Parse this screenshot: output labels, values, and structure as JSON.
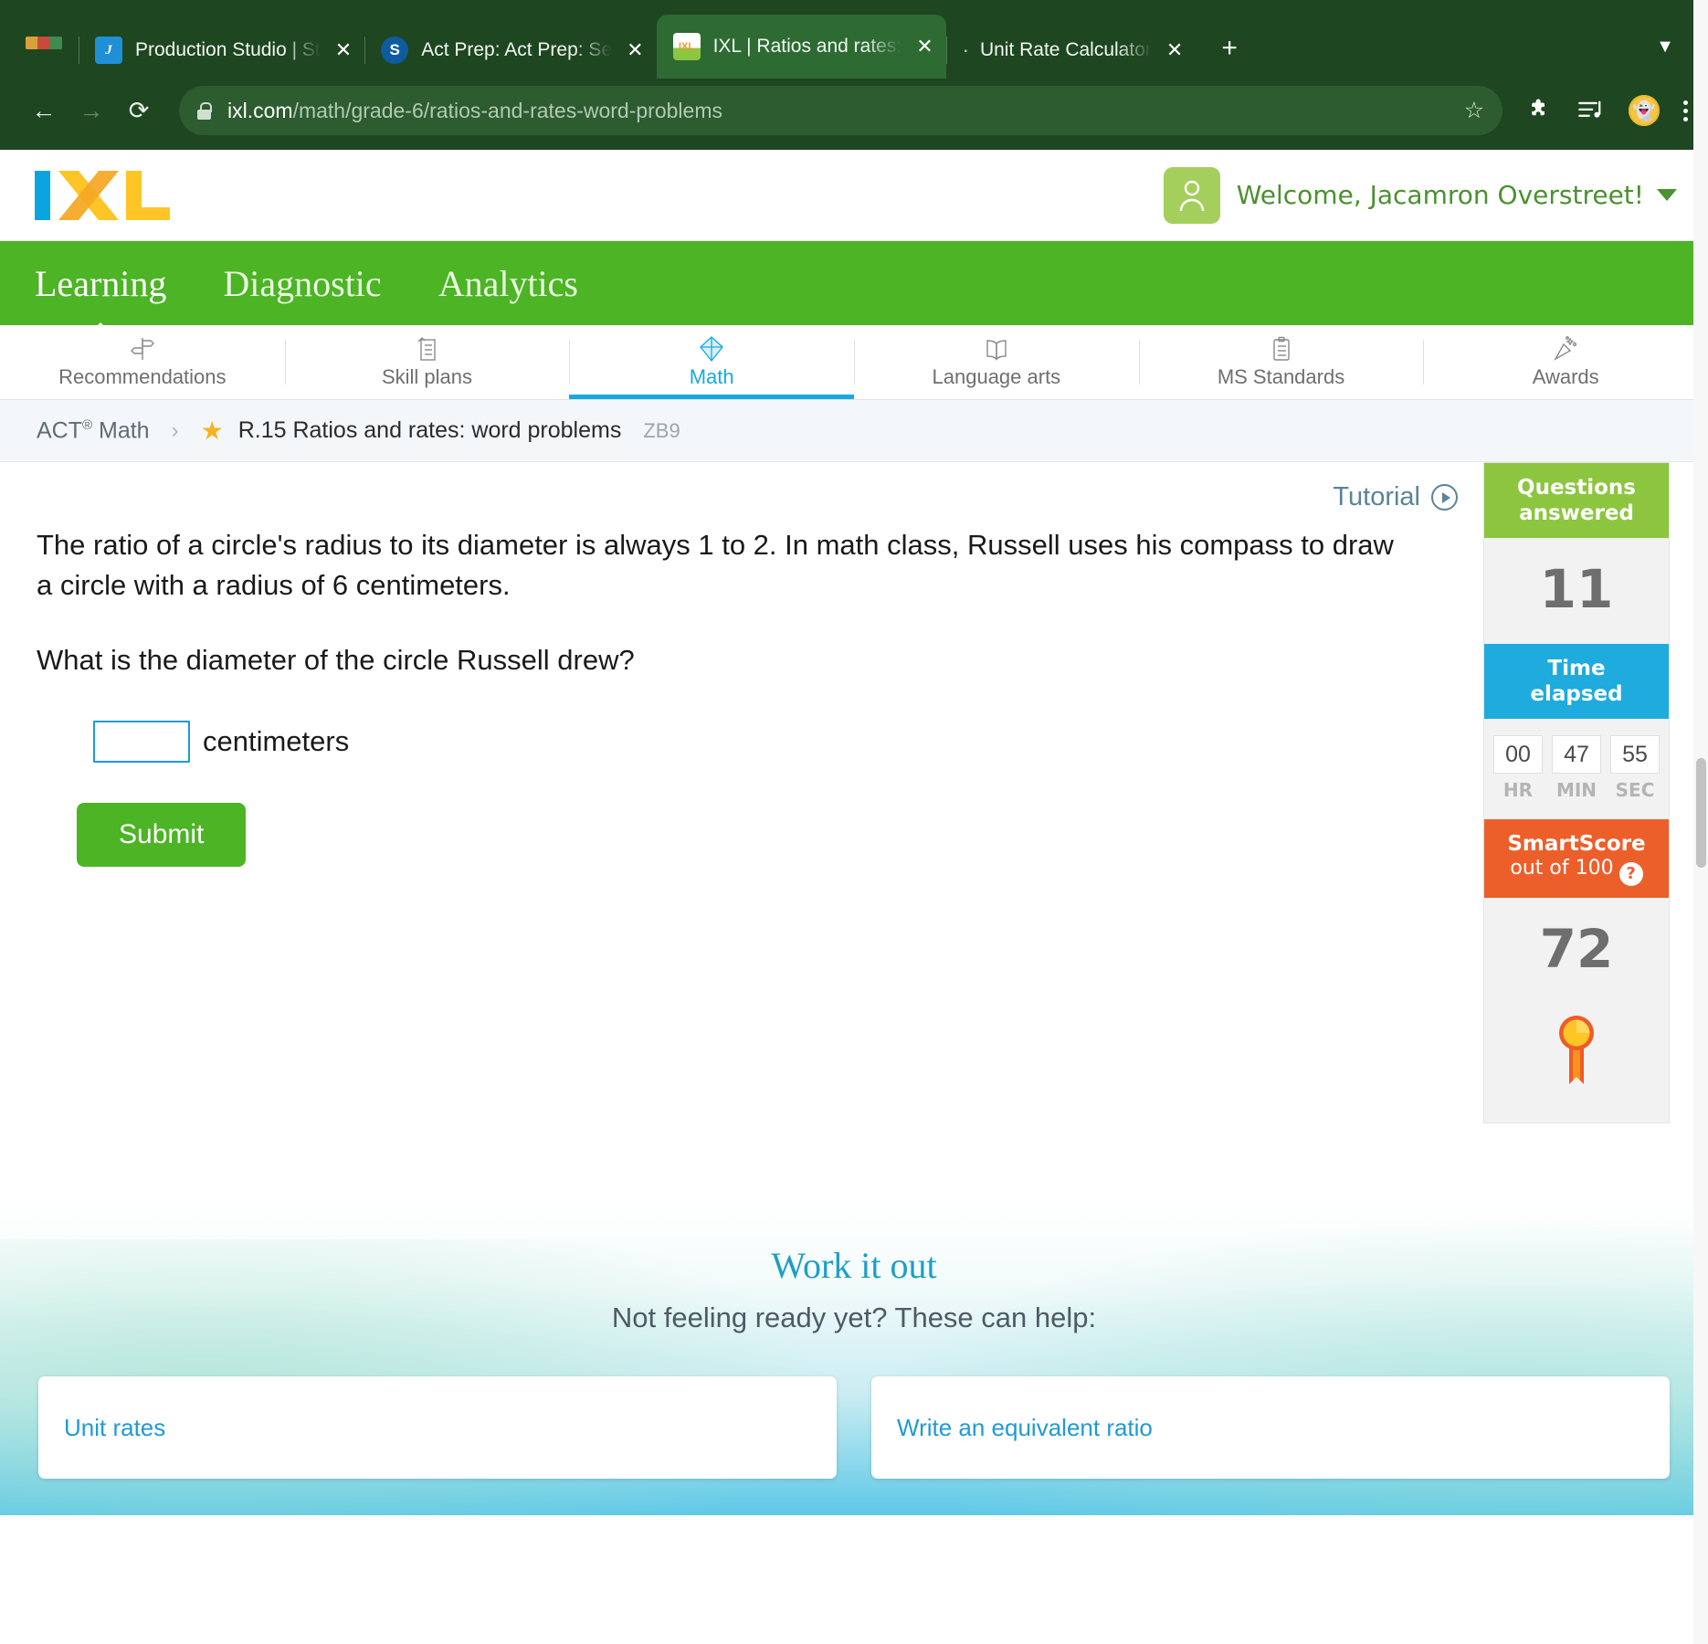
{
  "browser": {
    "tabs": [
      {
        "title": "Production Studio | St",
        "favicon": "production-studio-icon",
        "close": "✕",
        "active": false
      },
      {
        "title": "Act Prep: Act Prep: Se",
        "favicon": "act-prep-icon",
        "close": "✕",
        "active": false
      },
      {
        "title": "IXL | Ratios and rates:",
        "favicon": "ixl-icon",
        "close": "✕",
        "active": true
      },
      {
        "title": "Unit Rate Calculator",
        "favicon": "bullet-icon",
        "close": "✕",
        "active": false
      }
    ],
    "new_tab_label": "+",
    "url_prefix": "ixl.com",
    "url_path": "/math/grade-6/ratios-and-rates-word-problems",
    "url_full": "ixl.com/math/grade-6/ratios-and-rates-word-problems",
    "icons": {
      "back": "←",
      "forward": "→",
      "reload": "⟳",
      "lock": "lock-icon",
      "bookmark": "☆",
      "extensions": "puzzle-icon",
      "media": "media-icon",
      "profile": "snapchat-avatar-icon",
      "menu": "kebab-menu-icon",
      "tab_list": "tab-list-icon"
    }
  },
  "header": {
    "logo_text": "IXL",
    "welcome": "Welcome, Jacamron Overstreet!",
    "user_icon": "user-avatar-icon",
    "caret": "chevron-down-icon"
  },
  "main_nav": {
    "items": [
      {
        "label": "Learning",
        "active": true
      },
      {
        "label": "Diagnostic",
        "active": false
      },
      {
        "label": "Analytics",
        "active": false
      }
    ]
  },
  "subject_tabs": [
    {
      "label": "Recommendations",
      "icon": "signpost-icon",
      "active": false
    },
    {
      "label": "Skill plans",
      "icon": "checklist-icon",
      "active": false
    },
    {
      "label": "Math",
      "icon": "diamond-icon",
      "active": true
    },
    {
      "label": "Language arts",
      "icon": "open-book-icon",
      "active": false
    },
    {
      "label": "MS Standards",
      "icon": "clipboard-icon",
      "active": false
    },
    {
      "label": "Awards",
      "icon": "party-popper-icon",
      "active": false
    }
  ],
  "breadcrumb": {
    "root": "ACT",
    "root_sup": "®",
    "root_tail": " Math",
    "separator": "›",
    "star": "★",
    "current": "R.15 Ratios and rates: word problems",
    "code": "ZB9"
  },
  "question": {
    "tutorial_label": "Tutorial",
    "play_icon": "play-circle-icon",
    "paragraph1": "The ratio of a circle's radius to its diameter is always 1 to 2. In math class, Russell uses his compass to draw a circle with a radius of 6 centimeters.",
    "paragraph2": "What is the diameter of the circle Russell drew?",
    "answer_value": "",
    "answer_placeholder": "",
    "unit_label": "centimeters",
    "submit_label": "Submit"
  },
  "score_panel": {
    "questions_title_line1": "Questions",
    "questions_title_line2": "answered",
    "questions_value": "11",
    "time_title_line1": "Time",
    "time_title_line2": "elapsed",
    "time": {
      "hours": "00",
      "minutes": "47",
      "seconds": "55"
    },
    "time_labels": {
      "hr": "HR",
      "min": "MIN",
      "sec": "SEC"
    },
    "smartscore_title": "SmartScore",
    "smartscore_subtitle": "out of 100",
    "smartscore_help": "?",
    "smartscore_value": "72",
    "ribbon_icon": "award-ribbon-icon"
  },
  "work_it_out": {
    "title": "Work it out",
    "subtitle": "Not feeling ready yet? These can help:",
    "cards": [
      {
        "label": "Unit rates"
      },
      {
        "label": "Write an equivalent ratio"
      }
    ]
  },
  "colors": {
    "chrome_green": "#1e4620",
    "ixl_green": "#4cb425",
    "accent_blue": "#17aae0",
    "questions_green": "#8cc63f",
    "time_blue": "#1fabdd",
    "smartscore_orange": "#ec5f2b",
    "star_gold": "#f5b324"
  }
}
